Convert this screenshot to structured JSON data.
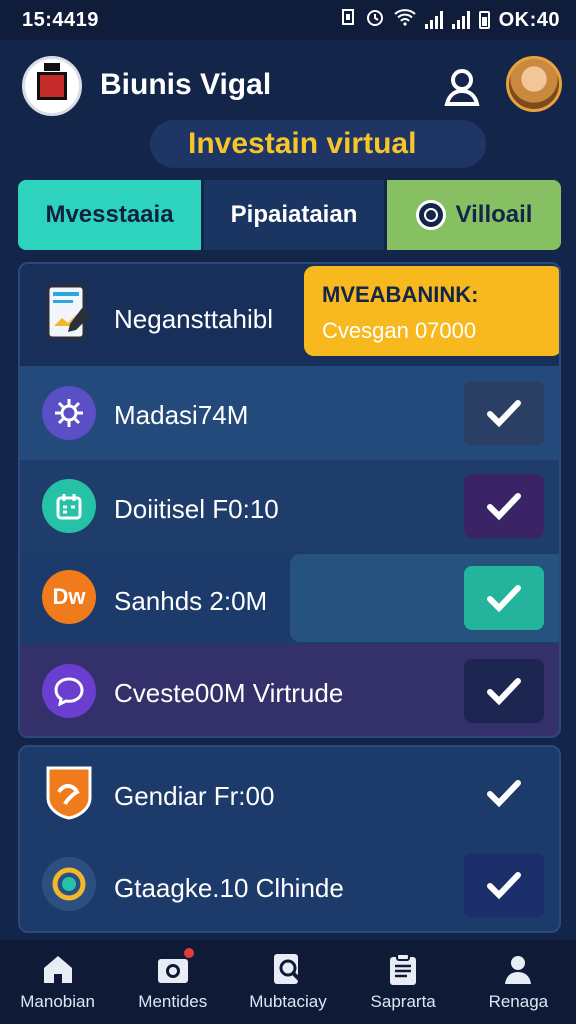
{
  "status_bar": {
    "left_time": "15:4419",
    "right_time": "OK:40"
  },
  "header": {
    "app_title": "Biunis Vigal",
    "subtitle": "Investain virtual"
  },
  "tabs": [
    {
      "label": "Mvesstaaia",
      "color": "#2ed3bd"
    },
    {
      "label": "Pipaiataian",
      "color": "#1b3563"
    },
    {
      "label": "Villoail",
      "color": "#86c062"
    }
  ],
  "summary_card": {
    "title": "MVEABANINK:",
    "value": "Cvesgan 07000",
    "color": "#f7b91e"
  },
  "list": [
    {
      "label": "Negansttahibl",
      "icon": "document-icon"
    },
    {
      "label": "Madasi74M",
      "icon": "gear-icon",
      "checked": true
    },
    {
      "label": "Doiitisel F0:10",
      "icon": "calendar-icon",
      "checked": true
    },
    {
      "label": "Sanhds 2:0M",
      "icon": "dw-icon",
      "icon_text": "Dw",
      "checked": true
    },
    {
      "label": "Cveste00M Virtrude",
      "icon": "chat-icon",
      "checked": true
    }
  ],
  "list2": [
    {
      "label": "Gendiar Fr:00",
      "icon": "shield-icon",
      "checked": true
    },
    {
      "label": "Gtaagke.10 Clhinde",
      "icon": "circle-icon",
      "checked": true
    }
  ],
  "nav": [
    {
      "label": "Manobian",
      "icon": "home-icon"
    },
    {
      "label": "Mentides",
      "icon": "camera-icon"
    },
    {
      "label": "Mubtaciay",
      "icon": "search-doc-icon"
    },
    {
      "label": "Saprarta",
      "icon": "clipboard-icon"
    },
    {
      "label": "Renaga",
      "icon": "profile-icon"
    }
  ]
}
